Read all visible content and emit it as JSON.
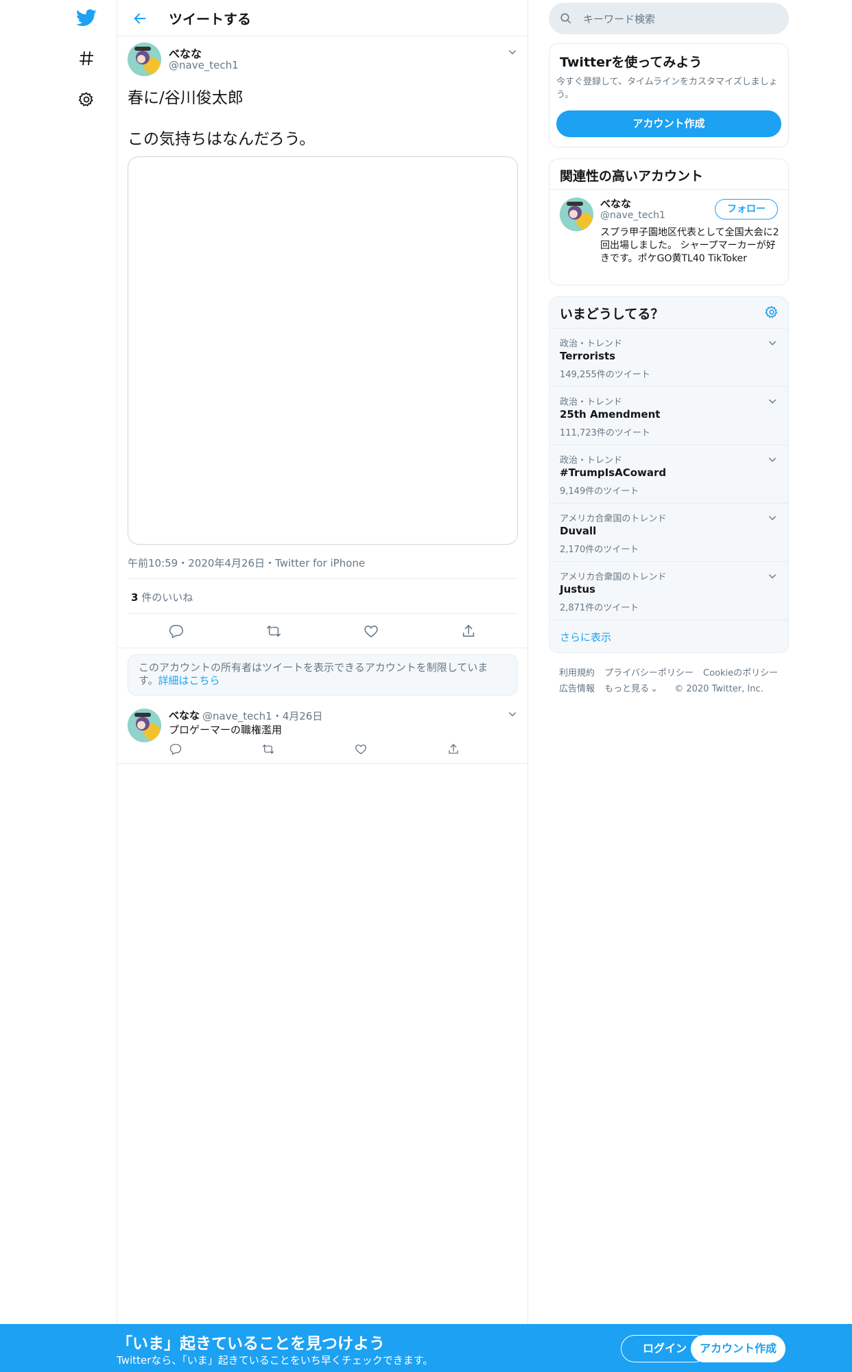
{
  "header": {
    "title": "ツイートする"
  },
  "tweet": {
    "name": "べなな",
    "handle": "@nave_tech1",
    "line1": "春に/谷川俊太郎",
    "line2": "この気持ちはなんだろう。",
    "meta": "午前10:59・2020年4月26日・Twitter for iPhone",
    "likes_count": "3",
    "likes_label": "件のいいね"
  },
  "notice": {
    "text": "このアカウントの所有者はツイートを表示できるアカウントを制限しています。",
    "link": "詳細はこちら"
  },
  "reply": {
    "name": "べなな",
    "handle_date": "@nave_tech1・4月26日",
    "text": "プロゲーマーの職権濫用"
  },
  "search": {
    "placeholder": "キーワード検索"
  },
  "signup_card": {
    "title": "Twitterを使ってみよう",
    "desc": "今すぐ登録して、タイムラインをカスタマイズしましょう。",
    "button": "アカウント作成"
  },
  "related": {
    "title": "関連性の高いアカウント",
    "name": "べなな",
    "handle": "@nave_tech1",
    "follow": "フォロー",
    "bio": "スプラ甲子園地区代表として全国大会に2回出場しました。 シャープマーカーが好きです。ポケGO黄TL40 TikToker"
  },
  "trends": {
    "title": "いまどうしてる？",
    "items": [
      {
        "category": "政治・トレンド",
        "name": "Terrorists",
        "count": "149,255件のツイート"
      },
      {
        "category": "政治・トレンド",
        "name": "25th Amendment",
        "count": "111,723件のツイート"
      },
      {
        "category": "政治・トレンド",
        "name": "#TrumpIsACoward",
        "count": "9,149件のツイート"
      },
      {
        "category": "アメリカ合衆国のトレンド",
        "name": "Duvall",
        "count": "2,170件のツイート"
      },
      {
        "category": "アメリカ合衆国のトレンド",
        "name": "Justus",
        "count": "2,871件のツイート"
      }
    ],
    "more": "さらに表示"
  },
  "footer": {
    "terms": "利用規約",
    "privacy": "プライバシーポリシー",
    "cookie": "Cookieのポリシー",
    "ads": "広告情報",
    "more": "もっと見る",
    "copyright": "© 2020 Twitter, Inc."
  },
  "bottom_bar": {
    "headline": "「いま」起きていることを見つけよう",
    "sub": "Twitterなら、「いま」起きていることをいち早くチェックできます。",
    "login": "ログイン",
    "signup": "アカウント作成"
  },
  "colors": {
    "accent": "#1da1f2",
    "muted": "#657786",
    "border": "#e6ecf0"
  }
}
